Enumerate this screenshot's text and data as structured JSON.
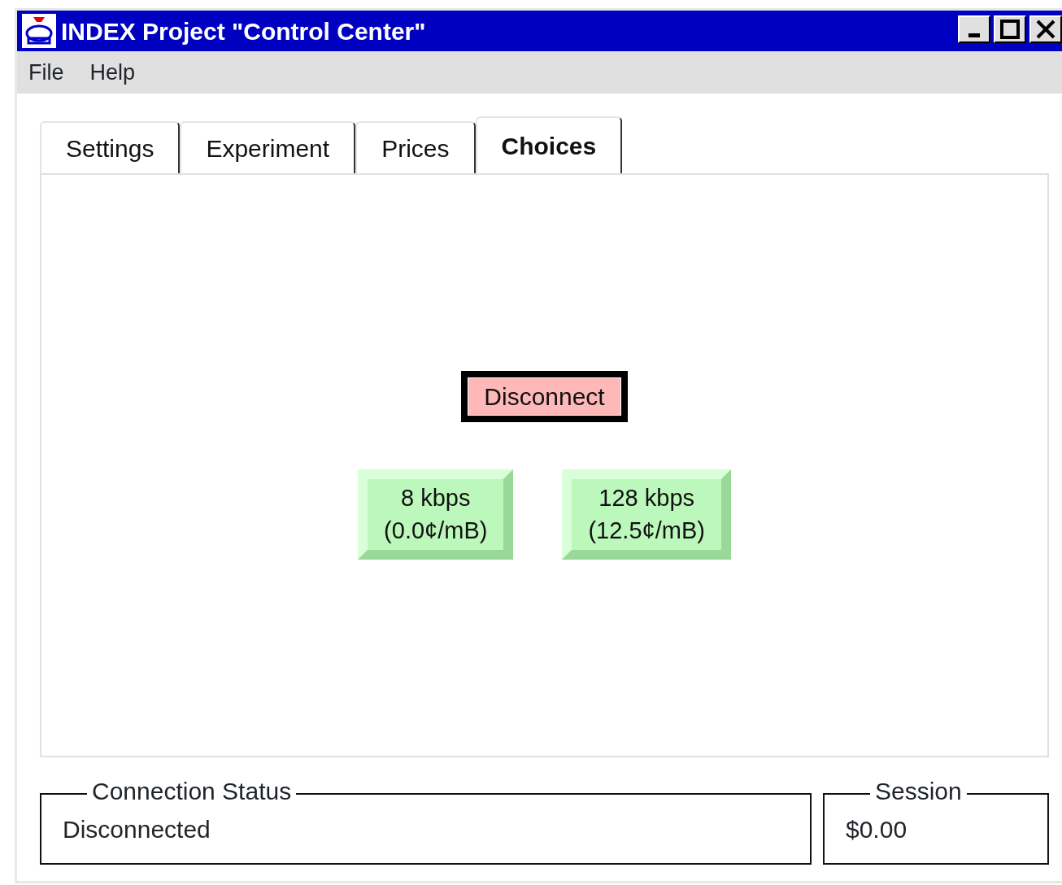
{
  "window": {
    "title": "INDEX Project \"Control Center\""
  },
  "menu": [
    "File",
    "Help"
  ],
  "tabs": [
    {
      "label": "Settings",
      "selected": false
    },
    {
      "label": "Experiment",
      "selected": false
    },
    {
      "label": "Prices",
      "selected": false
    },
    {
      "label": "Choices",
      "selected": true
    }
  ],
  "buttons": [
    {
      "kind": "disconnect",
      "lines": [
        "Disconnect"
      ]
    },
    {
      "kind": "rate",
      "lines": [
        "8 kbps",
        "(0.0¢/mB)"
      ]
    },
    {
      "kind": "rate",
      "lines": [
        "128 kbps",
        "(12.5¢/mB)"
      ]
    }
  ],
  "status": [
    {
      "title": "Connection Status",
      "value": "Disconnected"
    },
    {
      "title": "Session",
      "value": "$0.00"
    }
  ]
}
